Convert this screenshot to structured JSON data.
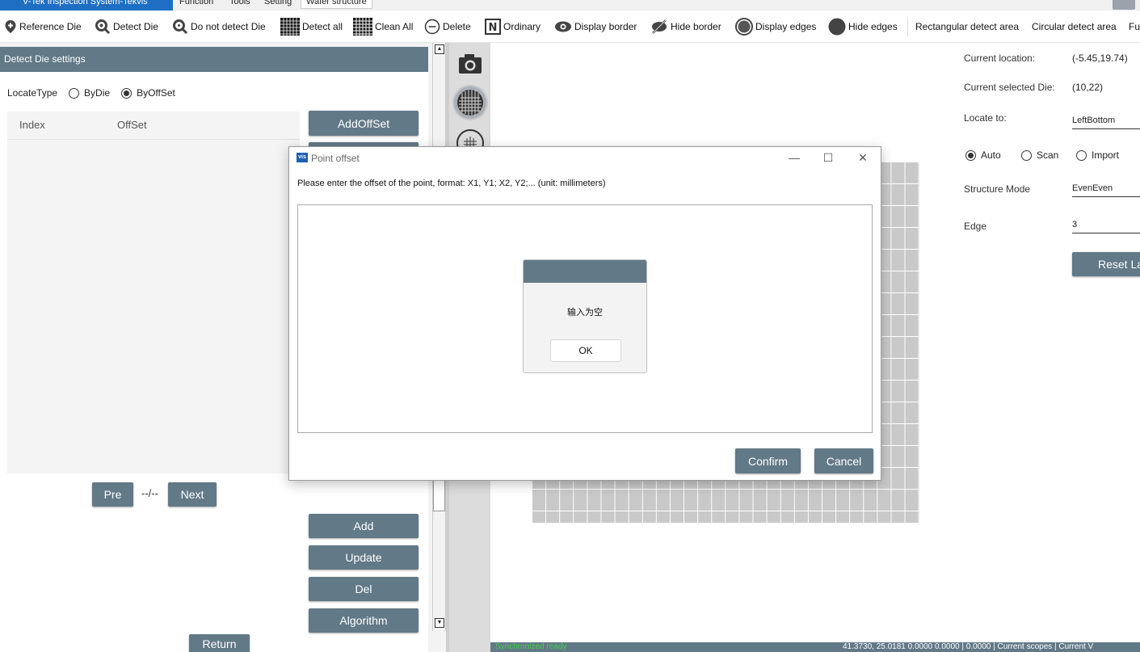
{
  "menubar": {
    "app_title": "V-Tek Inspection System-Tekvis",
    "menus": [
      "Function",
      "Tools",
      "Setting",
      "Wafer structure"
    ]
  },
  "toolbar": {
    "reference_die": "Reference Die",
    "detect_die": "Detect Die",
    "do_not_detect_die": "Do not detect Die",
    "detect_all": "Detect all",
    "clean_all": "Clean All",
    "delete": "Delete",
    "ordinary": "Ordinary",
    "display_border": "Display border",
    "hide_border": "Hide border",
    "display_edges": "Display edges",
    "hide_edges": "Hide edges",
    "rectangular_area": "Rectangular detect area",
    "circular_area": "Circular detect area",
    "full": "Ful"
  },
  "left_panel": {
    "header": "Detect Die settings",
    "locate_type_label": "LocateType",
    "options": [
      "ByDie",
      "ByOffSet"
    ],
    "selected": "ByOffSet",
    "columns": [
      "Index",
      "OffSet"
    ],
    "pager": {
      "pre": "Pre",
      "text": "--/--",
      "next": "Next"
    },
    "buttons": {
      "add_offset": "AddOffSet",
      "add": "Add",
      "update": "Update",
      "del": "Del",
      "algorithm": "Algorithm",
      "return": "Return"
    }
  },
  "right_panel": {
    "current_location_label": "Current location:",
    "current_location_value": "(-5.45,19.74)",
    "current_selected_die_label": "Current selected Die:",
    "current_selected_die_value": "(10,22)",
    "locate_to_label": "Locate to:",
    "locate_to_value": "LeftBottom",
    "modes": [
      "Auto",
      "Scan",
      "Import"
    ],
    "selected_mode": "Auto",
    "structure_mode_label": "Structure Mode",
    "structure_mode_value": "EvenEven",
    "edge_label": "Edge",
    "edge_value": "3",
    "reset_button": "Reset La"
  },
  "dialog": {
    "title": "Point offset",
    "instruction": "Please enter the offset of the point, format: X1, Y1; X2, Y2;... (unit: millimeters)",
    "input_value": "",
    "confirm": "Confirm",
    "cancel": "Cancel",
    "minimize": "—",
    "maximize": "☐",
    "close": "✕"
  },
  "message_box": {
    "text": "输入为空",
    "ok": "OK"
  },
  "statusbar": {
    "left": "Synchronized ready",
    "coords": "41.3730, 25.0181 0.0000 0.0000 | 0.0000 | Current scopes | Current V"
  },
  "colors": {
    "accent": "#627987",
    "brand_blue": "#1e6fc4"
  }
}
